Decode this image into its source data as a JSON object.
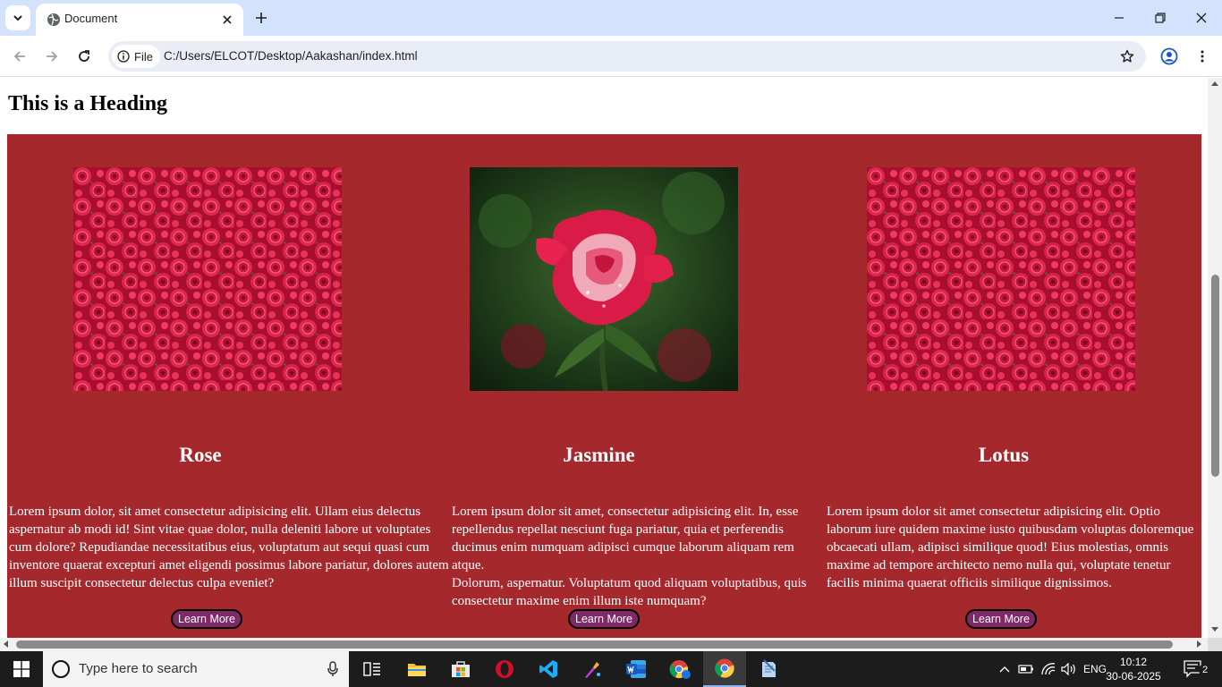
{
  "browser": {
    "tab_title": "Document",
    "site_chip_label": "File",
    "url": "C:/Users/ELCOT/Desktop/Aakashan/index.html"
  },
  "page": {
    "heading": "This is a Heading",
    "background_color": "#a5282c",
    "cards": [
      {
        "title": "Rose",
        "image": "red-roses-bunch",
        "text_lines": [
          "Lorem ipsum dolor, sit amet consectetur adipisicing elit. Ullam eius delectus",
          "aspernatur ab modi id! Sint vitae quae dolor, nulla deleniti labore ut voluptates",
          "cum dolore? Repudiandae necessitatibus eius, voluptatum aut sequi quasi cum",
          "inventore quaerat excepturi amet eligendi possimus labore pariatur, dolores autem",
          "illum suscipit consectetur delectus culpa eveniet?"
        ],
        "button": "Learn More"
      },
      {
        "title": "Jasmine",
        "image": "single-red-rose",
        "text_lines": [
          "Lorem ipsum dolor sit amet, consectetur adipisicing elit. In, esse",
          "repellendus repellat nesciunt fuga pariatur, quia et perferendis",
          "ducimus enim numquam adipisci cumque laborum aliquam rem atque.",
          "Dolorum, aspernatur. Voluptatum quod aliquam voluptatibus, quis",
          "consectetur maxime enim illum iste numquam?"
        ],
        "button": "Learn More"
      },
      {
        "title": "Lotus",
        "image": "red-roses-bunch",
        "text_lines": [
          "Lorem ipsum dolor sit amet consectetur adipisicing elit. Optio",
          "laborum iure quidem maxime iusto quibusdam voluptas doloremque",
          "obcaecati ullam, adipisci similique quod! Eius molestias, omnis",
          "maxime ad tempore architecto nemo nulla qui, voluptate tenetur",
          "facilis minima quaerat officiis similique dignissimos."
        ],
        "button": "Learn More"
      }
    ]
  },
  "taskbar": {
    "search_placeholder": "Type here to search",
    "language": "ENG",
    "time": "10:12",
    "date": "30-06-2025",
    "notification_count": "2",
    "apps": [
      "task-view",
      "file-explorer",
      "microsoft-store",
      "opera",
      "vscode",
      "paint",
      "word",
      "chrome-profile",
      "chrome",
      "notepad"
    ]
  }
}
